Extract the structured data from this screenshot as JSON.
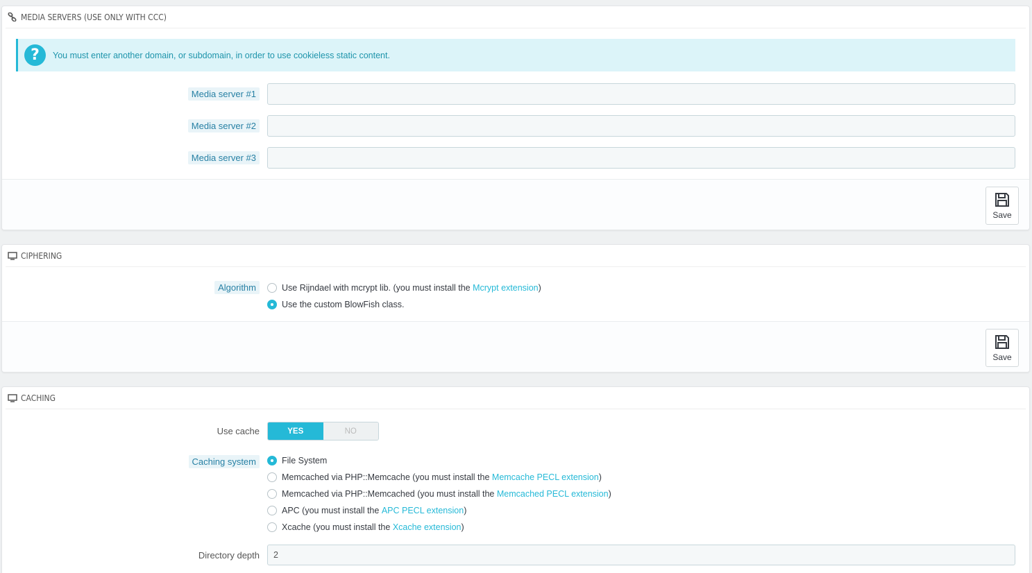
{
  "media_servers": {
    "title": "MEDIA SERVERS (USE ONLY WITH CCC)",
    "alert": "You must enter another domain, or subdomain, in order to use cookieless static content.",
    "fields": [
      {
        "label": "Media server #1",
        "value": ""
      },
      {
        "label": "Media server #2",
        "value": ""
      },
      {
        "label": "Media server #3",
        "value": ""
      }
    ],
    "save_label": "Save"
  },
  "ciphering": {
    "title": "CIPHERING",
    "algorithm_label": "Algorithm",
    "options": [
      {
        "text": "Use Rijndael with mcrypt lib. (you must install the ",
        "link": "Mcrypt extension",
        "suffix": ")",
        "checked": false
      },
      {
        "text": "Use the custom BlowFish class.",
        "link": "",
        "suffix": "",
        "checked": true
      }
    ],
    "save_label": "Save"
  },
  "caching": {
    "title": "CACHING",
    "use_cache_label": "Use cache",
    "yes_label": "YES",
    "no_label": "NO",
    "use_cache_value": "YES",
    "system_label": "Caching system",
    "options": [
      {
        "text": "File System",
        "link": "",
        "suffix": "",
        "checked": true
      },
      {
        "text": "Memcached via PHP::Memcache (you must install the ",
        "link": "Memcache PECL extension",
        "suffix": ")",
        "checked": false
      },
      {
        "text": "Memcached via PHP::Memcached (you must install the ",
        "link": "Memcached PECL extension",
        "suffix": ")",
        "checked": false
      },
      {
        "text": "APC (you must install the ",
        "link": "APC PECL extension",
        "suffix": ")",
        "checked": false
      },
      {
        "text": "Xcache (you must install the ",
        "link": "Xcache extension",
        "suffix": ")",
        "checked": false
      }
    ],
    "depth_label": "Directory depth",
    "depth_value": "2"
  },
  "colors": {
    "accent": "#25b9d7",
    "alert_bg": "#dcf4f9",
    "page_bg": "#eff1f2"
  },
  "icons": {
    "media": "link-icon",
    "ciphering": "desktop-icon",
    "caching": "desktop-icon",
    "save": "floppy-disk-icon",
    "alert": "question-icon"
  }
}
